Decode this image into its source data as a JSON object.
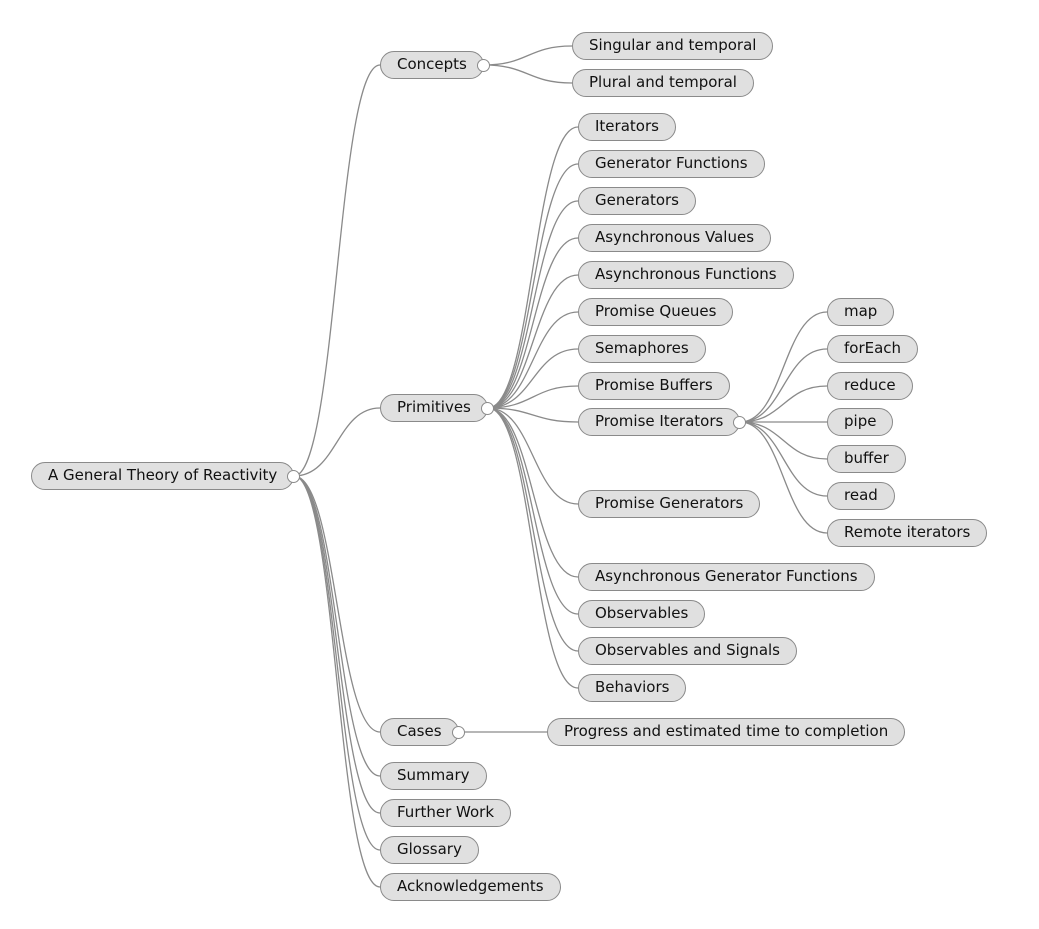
{
  "mindmap": {
    "colors": {
      "node_fill": "#e0e0e0",
      "node_border": "#8a8a8a",
      "link": "#8a8a8a",
      "text": "#111111"
    },
    "root": {
      "id": "root",
      "label": "A General Theory of Reactivity",
      "expanded": true,
      "children": [
        {
          "id": "concepts",
          "label": "Concepts",
          "expanded": true,
          "children": [
            {
              "id": "singular-temporal",
              "label": "Singular and temporal"
            },
            {
              "id": "plural-temporal",
              "label": "Plural and temporal"
            }
          ]
        },
        {
          "id": "primitives",
          "label": "Primitives",
          "expanded": true,
          "children": [
            {
              "id": "iterators",
              "label": "Iterators"
            },
            {
              "id": "generator-functions",
              "label": "Generator Functions"
            },
            {
              "id": "generators",
              "label": "Generators"
            },
            {
              "id": "asynchronous-values",
              "label": "Asynchronous Values"
            },
            {
              "id": "asynchronous-functions",
              "label": "Asynchronous Functions"
            },
            {
              "id": "promise-queues",
              "label": "Promise Queues"
            },
            {
              "id": "semaphores",
              "label": "Semaphores"
            },
            {
              "id": "promise-buffers",
              "label": "Promise Buffers"
            },
            {
              "id": "promise-iterators",
              "label": "Promise Iterators",
              "expanded": true,
              "children": [
                {
                  "id": "map",
                  "label": "map"
                },
                {
                  "id": "foreach",
                  "label": "forEach"
                },
                {
                  "id": "reduce",
                  "label": "reduce"
                },
                {
                  "id": "pipe",
                  "label": "pipe"
                },
                {
                  "id": "buffer",
                  "label": "buffer"
                },
                {
                  "id": "read",
                  "label": "read"
                },
                {
                  "id": "remote-iterators",
                  "label": "Remote iterators"
                }
              ]
            },
            {
              "id": "promise-generators",
              "label": "Promise Generators"
            },
            {
              "id": "async-generator-functions",
              "label": "Asynchronous Generator Functions"
            },
            {
              "id": "observables",
              "label": "Observables"
            },
            {
              "id": "observables-signals",
              "label": "Observables and Signals"
            },
            {
              "id": "behaviors",
              "label": "Behaviors"
            }
          ]
        },
        {
          "id": "cases",
          "label": "Cases",
          "expanded": true,
          "children": [
            {
              "id": "progress-eta",
              "label": "Progress and estimated time to completion"
            }
          ]
        },
        {
          "id": "summary",
          "label": "Summary"
        },
        {
          "id": "further-work",
          "label": "Further Work"
        },
        {
          "id": "glossary",
          "label": "Glossary"
        },
        {
          "id": "acknowledgements",
          "label": "Acknowledgements"
        }
      ]
    }
  }
}
